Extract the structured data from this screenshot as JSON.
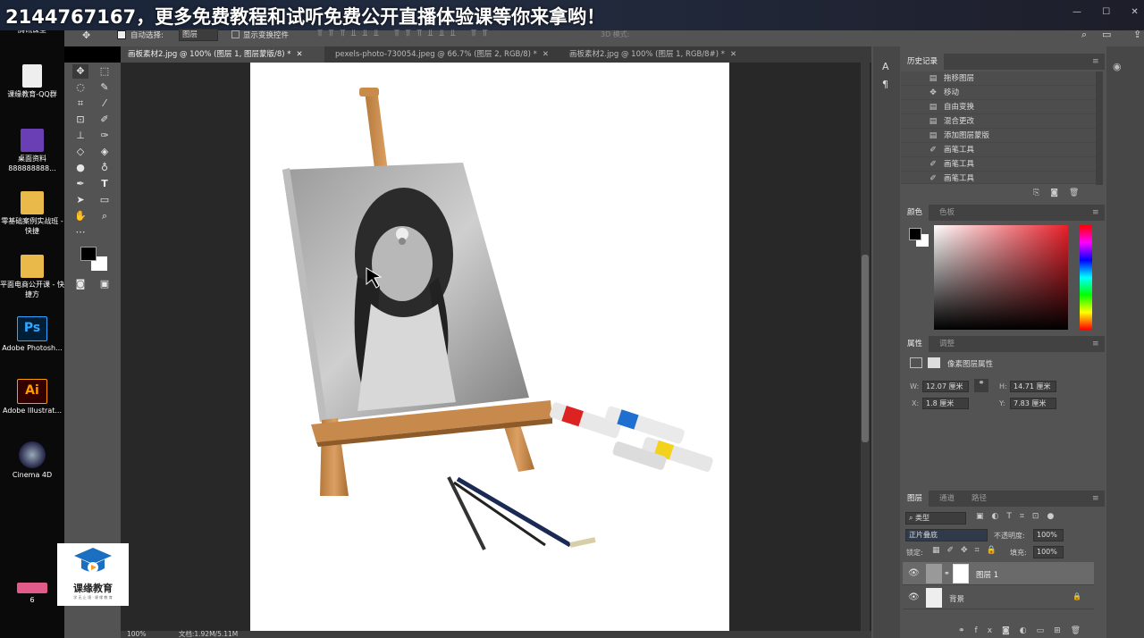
{
  "banner": {
    "text": "2144767167，更多免费教程和试听免费公开直播体验课等你来拿哟！"
  },
  "desktop": {
    "icons": [
      {
        "label": "腾讯课堂",
        "color": "#1e7fd8"
      },
      {
        "label": "课缘教育-QQ群",
        "color": "#e8e8e8"
      },
      {
        "label": "桌面资料888888888...",
        "color": "#6a3fb5"
      },
      {
        "label": "零基础案例实战班 - 快捷",
        "color": "#e9b949"
      },
      {
        "label": "平面电商公开课 - 快捷方",
        "color": "#e9b949"
      },
      {
        "label": "Adobe Photosh...",
        "color": "#31a8ff"
      },
      {
        "label": "Adobe Illustrat...",
        "color": "#ff9a00"
      },
      {
        "label": "Cinema 4D",
        "color": "#3d5afe"
      },
      {
        "label": "6",
        "color": "#e05a8a"
      }
    ],
    "watermark": {
      "name": "课缘教育",
      "sub": "学 无 止 境 · 课 缘 教 育"
    }
  },
  "options": {
    "auto_select_label": "自动选择:",
    "auto_select_value": "图层",
    "show_transform_label": "显示变换控件",
    "mode_3d": "3D 模式:"
  },
  "tabs": [
    {
      "label": "画板素材2.jpg @ 100% (图层 1, 图层蒙版/8) *"
    },
    {
      "label": "pexels-photo-730054.jpeg @ 66.7% (图层 2, RGB/8) *"
    },
    {
      "label": "画板素材2.jpg @ 100% (图层 1, RGB/8#) *"
    }
  ],
  "history": {
    "tab": "历史记录",
    "items": [
      {
        "label": "拖移图层",
        "icon": "doc-icon"
      },
      {
        "label": "移动",
        "icon": "move-icon"
      },
      {
        "label": "自由变换",
        "icon": "doc-icon"
      },
      {
        "label": "混合更改",
        "icon": "doc-icon"
      },
      {
        "label": "添加图层蒙版",
        "icon": "doc-icon"
      },
      {
        "label": "画笔工具",
        "icon": "brush-icon"
      },
      {
        "label": "画笔工具",
        "icon": "brush-icon"
      },
      {
        "label": "画笔工具",
        "icon": "brush-icon"
      }
    ]
  },
  "color_panel": {
    "tab_color": "颜色",
    "tab_swatches": "色板"
  },
  "properties": {
    "tab_props": "属性",
    "tab_adjust": "调整",
    "title": "像素图层属性",
    "w_label": "W:",
    "w": "12.07 厘米",
    "h_label": "H:",
    "h": "14.71 厘米",
    "x_label": "X:",
    "x": "1.8 厘米",
    "y_label": "Y:",
    "y": "7.83 厘米"
  },
  "layers": {
    "tab_layers": "图层",
    "tab_channels": "通道",
    "tab_paths": "路径",
    "filter": "类型",
    "blend_mode": "正片叠底",
    "opacity_label": "不透明度:",
    "opacity": "100%",
    "lock_label": "锁定:",
    "fill_label": "填充:",
    "fill": "100%",
    "items": [
      {
        "name": "图层 1"
      },
      {
        "name": "背景"
      }
    ]
  },
  "status": {
    "zoom": "100%",
    "doc": "文档:1.92M/5.11M"
  }
}
